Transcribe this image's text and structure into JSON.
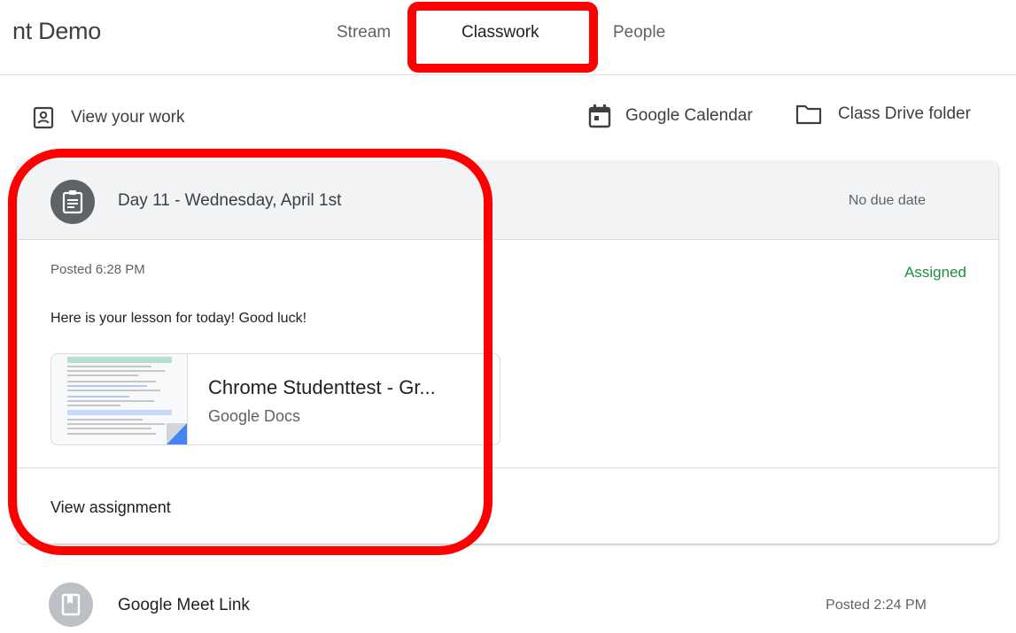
{
  "header": {
    "class_title": "nt Demo",
    "tabs": [
      {
        "label": "Stream",
        "active": false
      },
      {
        "label": "Classwork",
        "active": true
      },
      {
        "label": "People",
        "active": false
      }
    ]
  },
  "toolbar": {
    "view_work_label": "View your work",
    "calendar_label": "Google Calendar",
    "drive_label": "Class Drive folder",
    "icons": [
      "person-badge-icon",
      "calendar-icon",
      "folder-icon"
    ]
  },
  "assignment": {
    "icon": "assignment-icon",
    "title": "Day 11 - Wednesday, April 1st",
    "due": "No due date",
    "posted": "Posted 6:28 PM",
    "status": "Assigned",
    "instructions": "Here is your lesson for today! Good luck!",
    "attachment": {
      "title": "Chrome Studenttest - Gr...",
      "type": "Google Docs"
    },
    "view_label": "View assignment"
  },
  "material": {
    "icon": "material-icon",
    "title": "Google Meet Link",
    "posted": "Posted 2:24 PM"
  },
  "colors": {
    "highlight": "#ff0000",
    "assigned_status": "#1e8e3e",
    "docs_accent": "#4285f4",
    "header_bg": "#f1f3f4"
  }
}
